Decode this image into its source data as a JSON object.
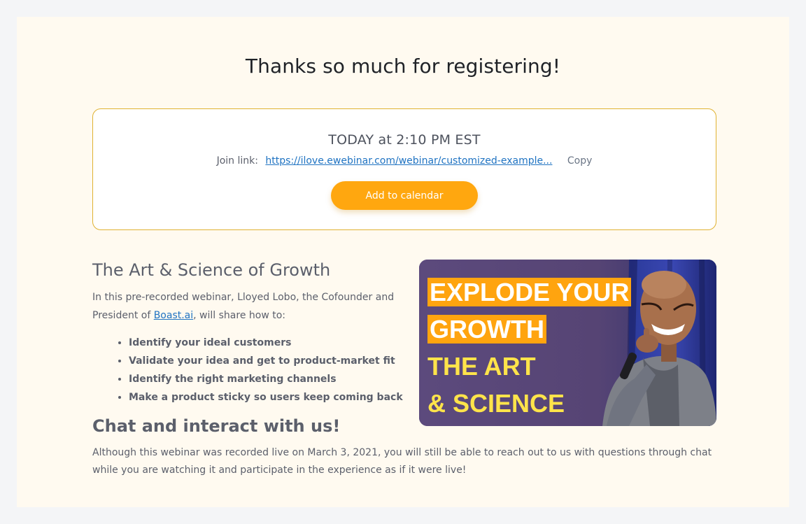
{
  "page": {
    "title": "Thanks so much for registering!"
  },
  "event": {
    "when": "TODAY at 2:10 PM EST",
    "join_label": "Join link:",
    "join_url": "https://ilove.ewebinar.com/webinar/customized-example...",
    "copy_label": "Copy",
    "calendar_button": "Add to calendar"
  },
  "about": {
    "heading": "The Art & Science of Growth",
    "desc_before": "In this pre-recorded webinar, Lloyed Lobo, the Cofounder and President of ",
    "desc_link": "Boast.ai",
    "desc_after": ", will share how to:",
    "bullets": [
      "Identify your ideal customers",
      "Validate your idea and get to product-market fit",
      "Identify the right marketing channels",
      "Make a product sticky so users keep coming back"
    ]
  },
  "thumbnail": {
    "lines": [
      "EXPLODE YOUR",
      "GROWTH",
      "THE ART",
      "& SCIENCE"
    ]
  },
  "chat": {
    "heading": "Chat and interact with us!",
    "body": "Although this webinar was recorded live on March 3, 2021, you will still be able to reach out to us with questions through chat while you are watching it and participate in the experience as if it were live!"
  },
  "colors": {
    "accent": "#ffa70f",
    "card_border": "#e0b232",
    "link": "#1f73c2",
    "panel_bg": "#fffaf0"
  }
}
